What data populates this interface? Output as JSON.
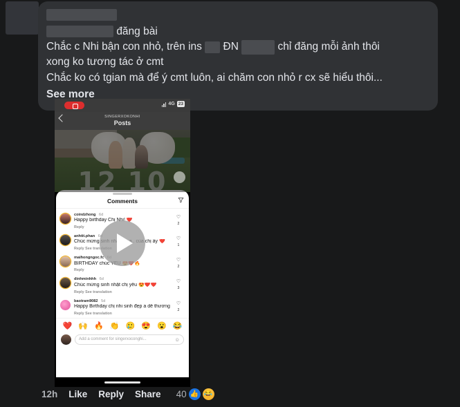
{
  "post": {
    "poster_suffix": "đăng bài",
    "lines": [
      "Chắc c Nhi bận con nhỏ, trên ins",
      "ĐN",
      "chỉ đăng mỗi ảnh thôi",
      "xong ko tương tác ở cmt",
      "Chắc ko có tgian mà để ý cmt luôn, ai chăm con nhỏ r cx sẽ hiểu thôi..."
    ],
    "see_more": "See more"
  },
  "media": {
    "status_bar": {
      "network": "4G",
      "battery": "23"
    },
    "instagram": {
      "handle": "SINGERXOKONHI",
      "title": "Posts",
      "photo_number": "12 10"
    },
    "sheet": {
      "header": "Comments",
      "comments": [
        {
          "user": "coindzhong",
          "time": "6d",
          "text": "Happy birthday Chị Nhi! ❤️",
          "actions": "Reply",
          "likes": "2"
        },
        {
          "user": "anhtit.phan",
          "time": "6d",
          "text": "Chúc mừng sinh nhật chị ạ.. của chị ấy ❤️",
          "actions": "Reply   See translation",
          "likes": "1"
        },
        {
          "user": "maihongngoc.fc",
          "time": "6d",
          "text": "BIRTHDAY chúc YÊU 😍❤️🔥",
          "actions": "Reply",
          "likes": "2"
        },
        {
          "user": "dinhminhhh",
          "time": "6d",
          "text": "Chúc mừng sinh nhật chị yêu 😍❤️❤️",
          "actions": "Reply   See translation",
          "likes": "3"
        },
        {
          "user": "baotram9082",
          "time": "5d",
          "text": "Happy Birthday chị nhi sinh đẹp a dễ thương",
          "actions": "Reply   See translation",
          "likes": "2"
        }
      ],
      "quick_emojis": [
        "❤️",
        "🙌",
        "🔥",
        "👏",
        "🥲",
        "😍",
        "😮",
        "😂"
      ],
      "input_placeholder": "Add a comment for singerxoconghi...",
      "sticker_icon": "sticker-icon"
    },
    "play_icon": "play-icon"
  },
  "footer": {
    "timestamp": "12h",
    "like": "Like",
    "reply": "Reply",
    "share": "Share",
    "reaction_count": "40",
    "reactions": [
      "like-reaction",
      "haha-reaction"
    ]
  },
  "colors": {
    "bg": "#18191a",
    "bubble": "#303235",
    "text": "#e4e6eb",
    "muted": "#b0b3b8",
    "fb_blue": "#1b74e4"
  }
}
